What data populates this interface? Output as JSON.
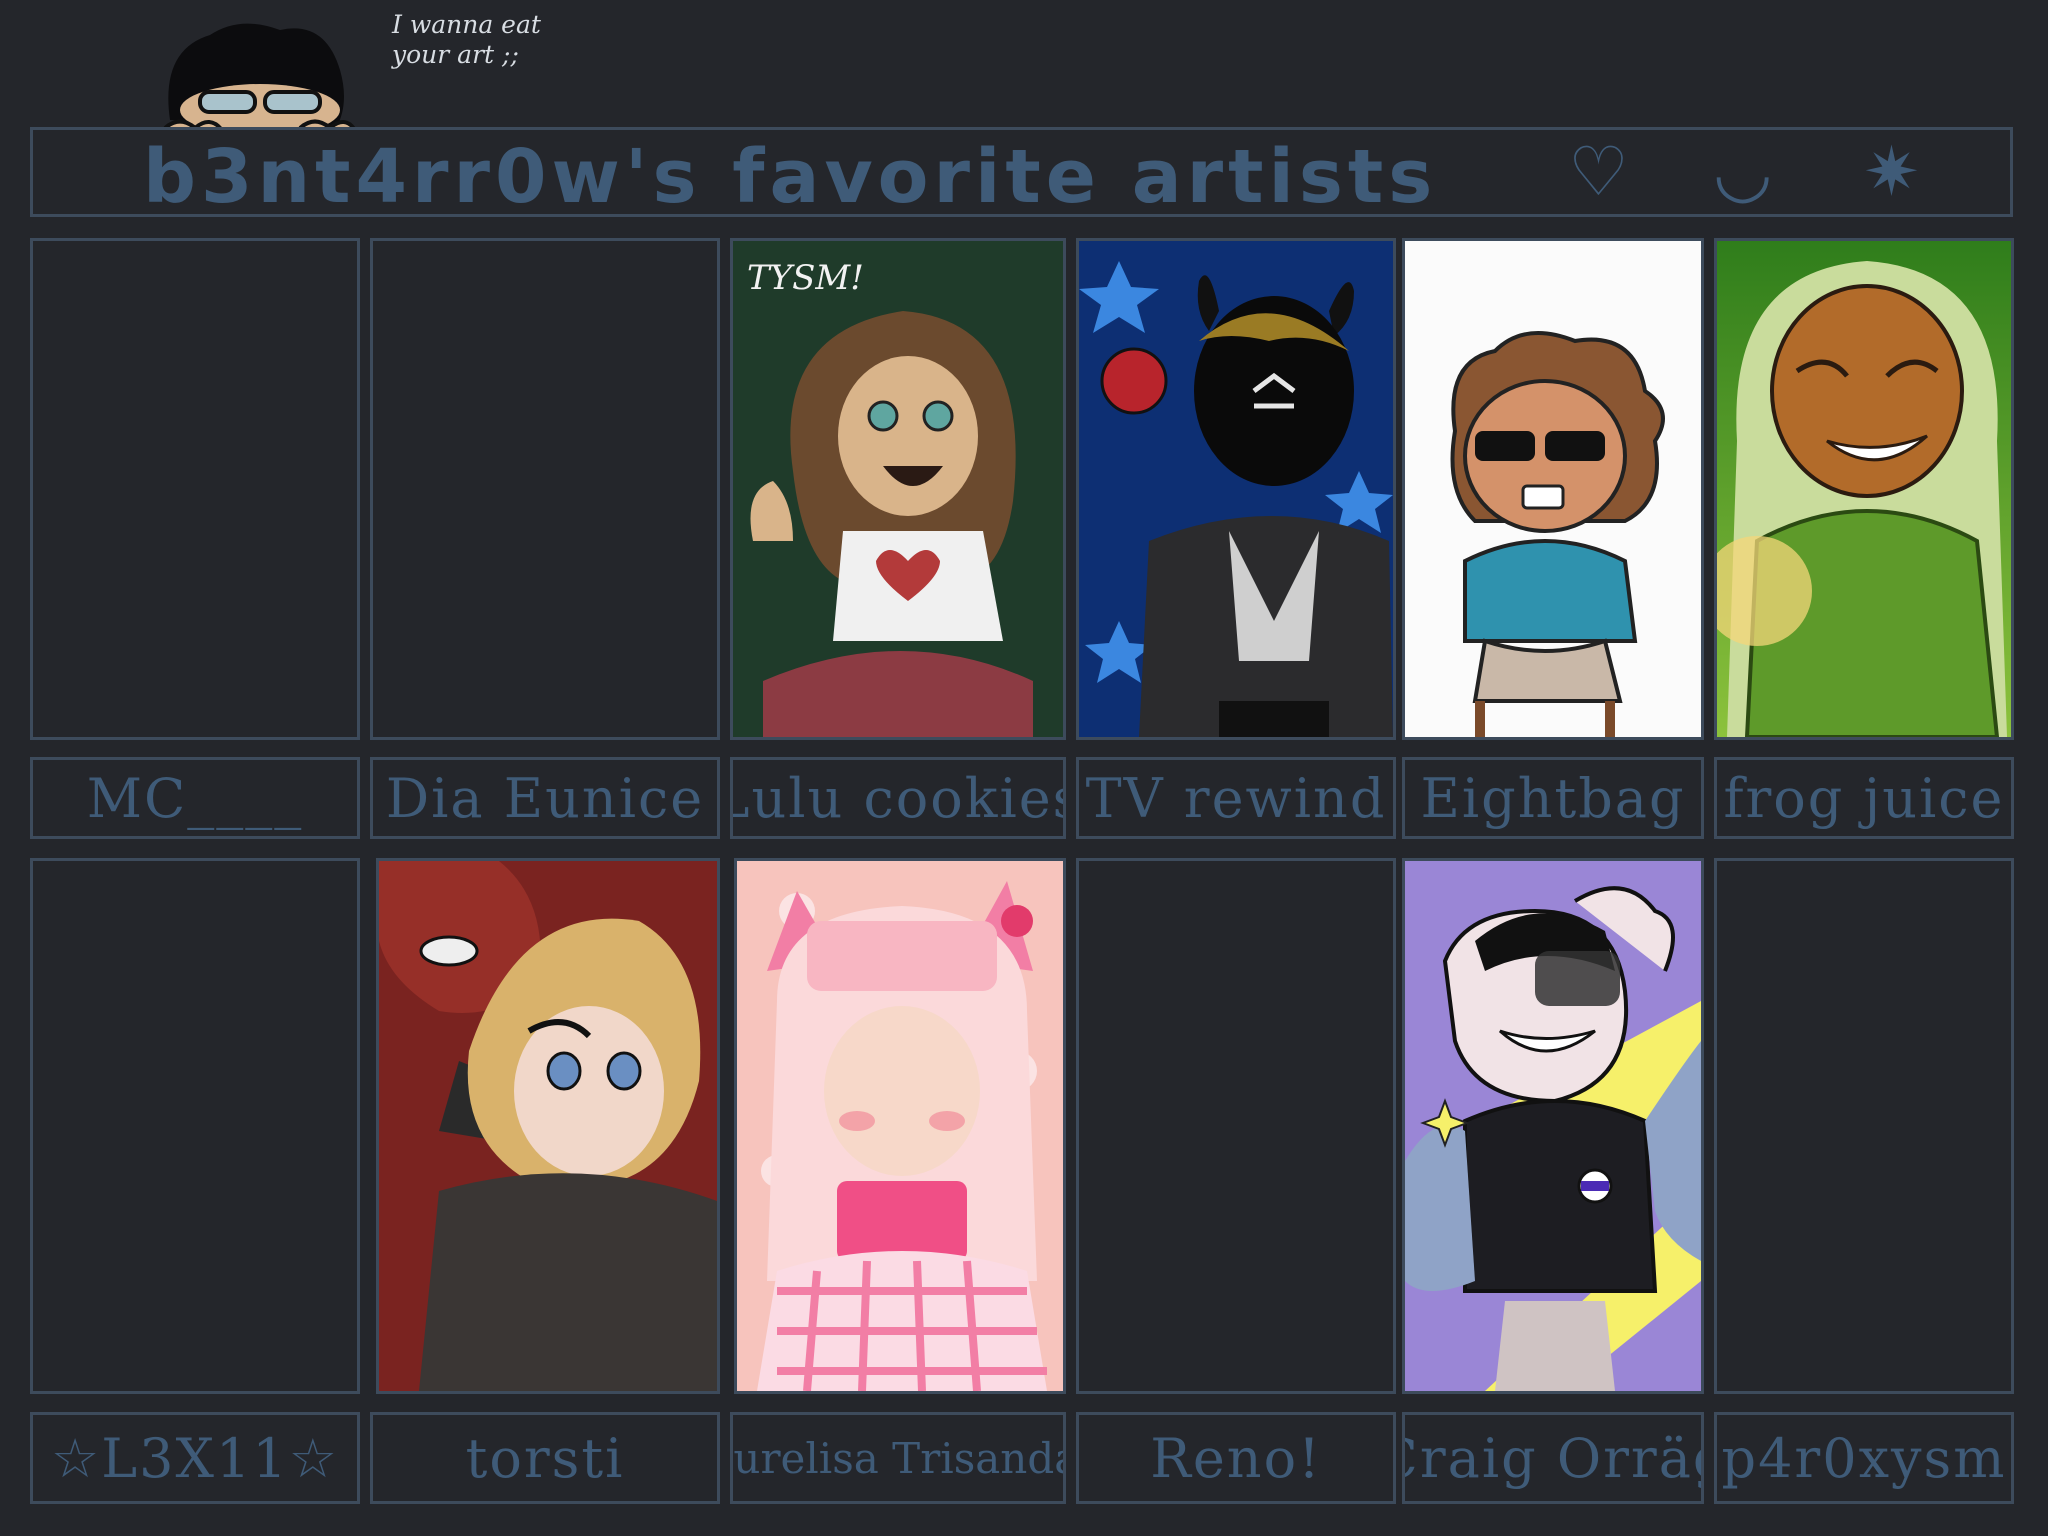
{
  "doodle_note": "I wanna eat your art ;;",
  "title": "b3nt4rr0w's favorite artists",
  "title_deco": {
    "heart": "♡",
    "smile": "◡",
    "star": "✷"
  },
  "row1": [
    {
      "name": "MC____",
      "has_art": false
    },
    {
      "name": "Dia Eunice",
      "has_art": false
    },
    {
      "name": "Lulu cookies",
      "has_art": true,
      "art_text": "TYSM!"
    },
    {
      "name": "TV rewind",
      "has_art": true
    },
    {
      "name": "Eightbag",
      "has_art": true
    },
    {
      "name": "frog juice",
      "has_art": true
    }
  ],
  "row2": [
    {
      "name": "☆L3X11☆",
      "has_art": false
    },
    {
      "name": "torsti",
      "has_art": true
    },
    {
      "name": "Nurelisa Trisandar",
      "has_art": true
    },
    {
      "name": "Reno!",
      "has_art": false
    },
    {
      "name": "Craig Orräg",
      "has_art": true
    },
    {
      "name": "p4r0xysm",
      "has_art": false
    }
  ],
  "colors": {
    "background": "#24262b",
    "frame": "#3d4b5c",
    "label_text": "#3f5b78"
  }
}
